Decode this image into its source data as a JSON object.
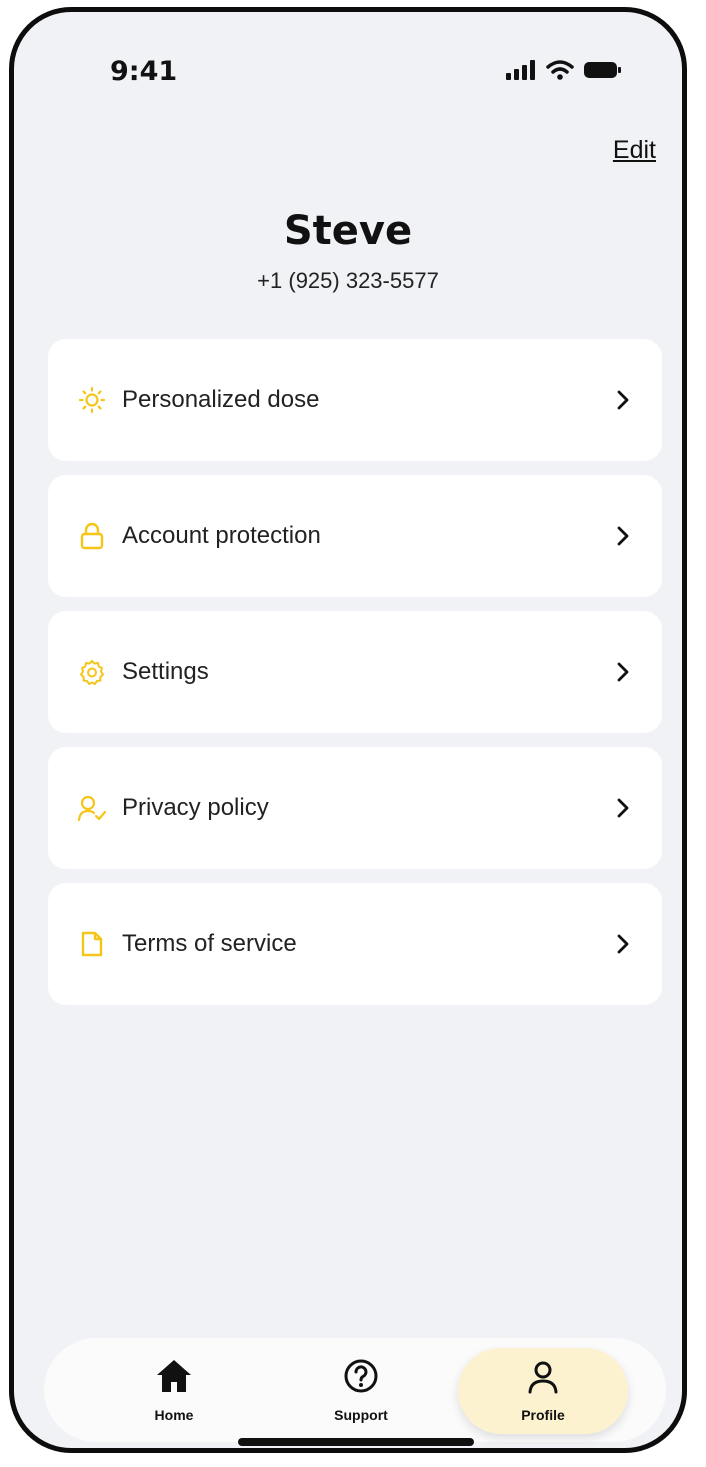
{
  "status_bar": {
    "time": "9:41"
  },
  "header": {
    "edit_label": "Edit"
  },
  "profile": {
    "name": "Steve",
    "phone": "+1 (925) 323-5577"
  },
  "menu": {
    "items": [
      {
        "label": "Personalized dose",
        "icon": "sun-icon"
      },
      {
        "label": "Account protection",
        "icon": "lock-icon"
      },
      {
        "label": "Settings",
        "icon": "gear-icon"
      },
      {
        "label": "Privacy policy",
        "icon": "user-check-icon"
      },
      {
        "label": "Terms of service",
        "icon": "document-icon"
      }
    ]
  },
  "tab_bar": {
    "tabs": [
      {
        "label": "Home",
        "icon": "home-icon"
      },
      {
        "label": "Support",
        "icon": "question-circle-icon"
      },
      {
        "label": "Profile",
        "icon": "user-icon",
        "active": true
      }
    ]
  },
  "colors": {
    "accent": "#f5c518",
    "background": "#f1f2f6",
    "card": "#ffffff",
    "active_tab": "#fcf2d0"
  }
}
